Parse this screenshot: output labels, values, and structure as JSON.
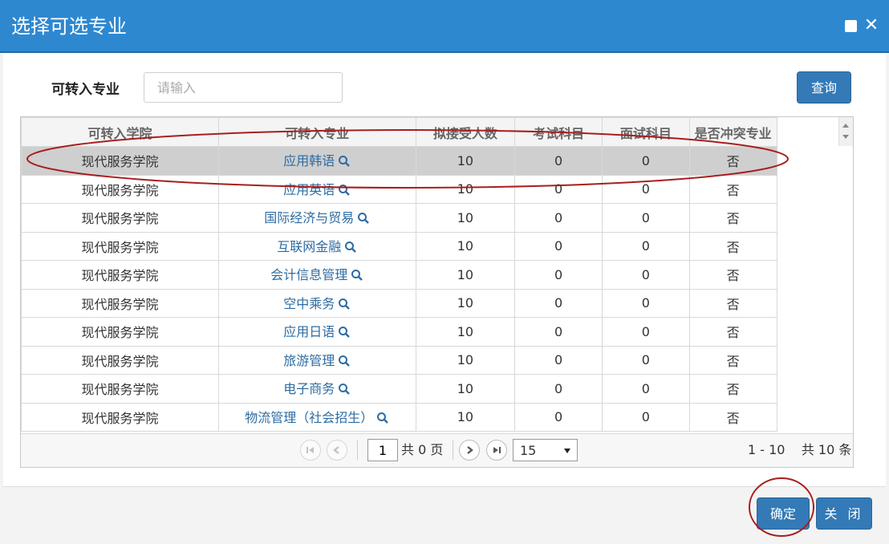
{
  "dialog": {
    "title": "选择可选专业"
  },
  "filter": {
    "label": "可转入专业",
    "placeholder": "请输入",
    "value": "",
    "query_label": "查询"
  },
  "grid": {
    "columns": [
      "可转入学院",
      "可转入专业",
      "拟接受人数",
      "考试科目",
      "面试科目",
      "是否冲突专业"
    ],
    "rows": [
      {
        "college": "现代服务学院",
        "major": "应用韩语",
        "quota": "10",
        "exam": "0",
        "interview": "0",
        "conflict": "否",
        "selected": true
      },
      {
        "college": "现代服务学院",
        "major": "应用英语",
        "quota": "10",
        "exam": "0",
        "interview": "0",
        "conflict": "否",
        "selected": false
      },
      {
        "college": "现代服务学院",
        "major": "国际经济与贸易",
        "quota": "10",
        "exam": "0",
        "interview": "0",
        "conflict": "否",
        "selected": false
      },
      {
        "college": "现代服务学院",
        "major": "互联网金融",
        "quota": "10",
        "exam": "0",
        "interview": "0",
        "conflict": "否",
        "selected": false
      },
      {
        "college": "现代服务学院",
        "major": "会计信息管理",
        "quota": "10",
        "exam": "0",
        "interview": "0",
        "conflict": "否",
        "selected": false
      },
      {
        "college": "现代服务学院",
        "major": "空中乘务",
        "quota": "10",
        "exam": "0",
        "interview": "0",
        "conflict": "否",
        "selected": false
      },
      {
        "college": "现代服务学院",
        "major": "应用日语",
        "quota": "10",
        "exam": "0",
        "interview": "0",
        "conflict": "否",
        "selected": false
      },
      {
        "college": "现代服务学院",
        "major": "旅游管理",
        "quota": "10",
        "exam": "0",
        "interview": "0",
        "conflict": "否",
        "selected": false
      },
      {
        "college": "现代服务学院",
        "major": "电子商务",
        "quota": "10",
        "exam": "0",
        "interview": "0",
        "conflict": "否",
        "selected": false
      },
      {
        "college": "现代服务学院",
        "major": "物流管理（社会招生）",
        "quota": "10",
        "exam": "0",
        "interview": "0",
        "conflict": "否",
        "selected": false
      }
    ]
  },
  "pager": {
    "current_page": "1",
    "total_pages": "共 0 页",
    "page_size": "15",
    "range": "1 - 10",
    "total": "共 10 条"
  },
  "footer": {
    "ok_label": "确定",
    "close_label": "关 闭"
  },
  "colors": {
    "titlebar": "#2e88d0",
    "button": "#337ab7",
    "link": "#2d6ca2",
    "annotation": "#a81e1e"
  },
  "icons": [
    "maximize-icon",
    "close-icon",
    "search-icon",
    "first-page-icon",
    "prev-page-icon",
    "next-page-icon",
    "last-page-icon",
    "dropdown-arrow-icon",
    "scroll-up-icon",
    "scroll-down-icon"
  ]
}
